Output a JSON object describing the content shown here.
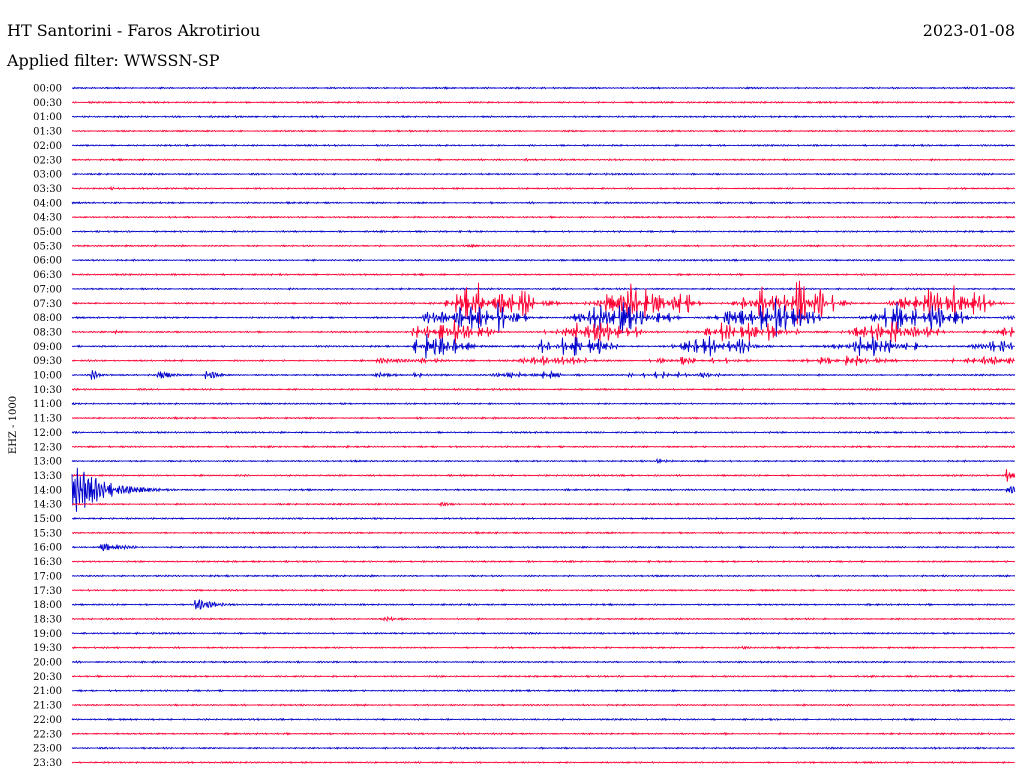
{
  "header": {
    "station": "HT Santorini - Faros Akrotiriou",
    "date": "2023-01-08",
    "filter": "Applied filter: WWSSN-SP"
  },
  "chart_data": {
    "type": "line",
    "title": "HT Santorini - Faros Akrotiriou",
    "ylabel": "EHZ - 1000",
    "xlabel": "",
    "rows": [
      "00:00",
      "00:30",
      "01:00",
      "01:30",
      "02:00",
      "02:30",
      "03:00",
      "03:30",
      "04:00",
      "04:30",
      "05:00",
      "05:30",
      "06:00",
      "06:30",
      "07:00",
      "07:30",
      "08:00",
      "08:30",
      "09:00",
      "09:30",
      "10:00",
      "10:30",
      "11:00",
      "11:30",
      "12:00",
      "12:30",
      "13:00",
      "13:30",
      "14:00",
      "14:30",
      "15:00",
      "15:30",
      "16:00",
      "16:30",
      "17:00",
      "17:30",
      "18:00",
      "18:30",
      "19:00",
      "19:30",
      "20:00",
      "20:30",
      "21:00",
      "21:30",
      "22:00",
      "22:30",
      "23:00",
      "23:30"
    ],
    "trace_colors": [
      "#0000cc",
      "#ff0033"
    ],
    "grid": false,
    "legend": "none",
    "events": [
      {
        "row": 5,
        "x": 0.48,
        "amp": 1.5,
        "len": 0.02
      },
      {
        "row": 5,
        "x": 0.2,
        "amp": 0.6,
        "len": 0.05
      },
      {
        "row": 7,
        "x": 0.04,
        "amp": 1.5,
        "len": 0.02
      },
      {
        "row": 11,
        "x": 0.42,
        "amp": 1.5,
        "len": 0.02
      },
      {
        "row": 11,
        "x": 0.26,
        "amp": 0.8,
        "len": 0.05
      },
      {
        "row": 17,
        "x": 0.04,
        "amp": 4,
        "len": 0.01
      },
      {
        "row": 19,
        "x": 0.32,
        "amp": 4,
        "len": 0.04
      },
      {
        "row": 20,
        "x": 0.02,
        "amp": 6,
        "len": 0.01
      },
      {
        "row": 20,
        "x": 0.09,
        "amp": 5,
        "len": 0.02
      },
      {
        "row": 20,
        "x": 0.14,
        "amp": 6,
        "len": 0.02
      },
      {
        "row": 20,
        "x": 0.32,
        "amp": 5,
        "len": 0.02
      },
      {
        "row": 28,
        "x": 0.0,
        "amp": 28,
        "len": 0.04
      },
      {
        "row": 28,
        "x": 0.99,
        "amp": 12,
        "len": 0.01
      },
      {
        "row": 27,
        "x": 0.99,
        "amp": 10,
        "len": 0.01
      },
      {
        "row": 29,
        "x": 0.39,
        "amp": 2,
        "len": 0.02
      },
      {
        "row": 32,
        "x": 0.03,
        "amp": 6,
        "len": 0.03
      },
      {
        "row": 36,
        "x": 0.13,
        "amp": 6,
        "len": 0.03
      },
      {
        "row": 37,
        "x": 0.33,
        "amp": 2.5,
        "len": 0.03
      },
      {
        "row": 39,
        "x": 0.71,
        "amp": 1.5,
        "len": 0.02
      },
      {
        "row": 45,
        "x": 0.69,
        "amp": 1.5,
        "len": 0.02
      },
      {
        "row": 26,
        "x": 0.62,
        "amp": 2,
        "len": 0.03
      }
    ],
    "swarms": [
      {
        "row": 15,
        "from": 0.37,
        "to": 1.0,
        "amp": 30
      },
      {
        "row": 16,
        "from": 0.37,
        "to": 1.0,
        "amp": 22
      },
      {
        "row": 17,
        "from": 0.36,
        "to": 1.0,
        "amp": 14
      },
      {
        "row": 18,
        "from": 0.36,
        "to": 1.0,
        "amp": 14
      },
      {
        "row": 19,
        "from": 0.36,
        "to": 1.0,
        "amp": 6
      },
      {
        "row": 20,
        "from": 0.36,
        "to": 0.7,
        "amp": 6
      }
    ]
  }
}
